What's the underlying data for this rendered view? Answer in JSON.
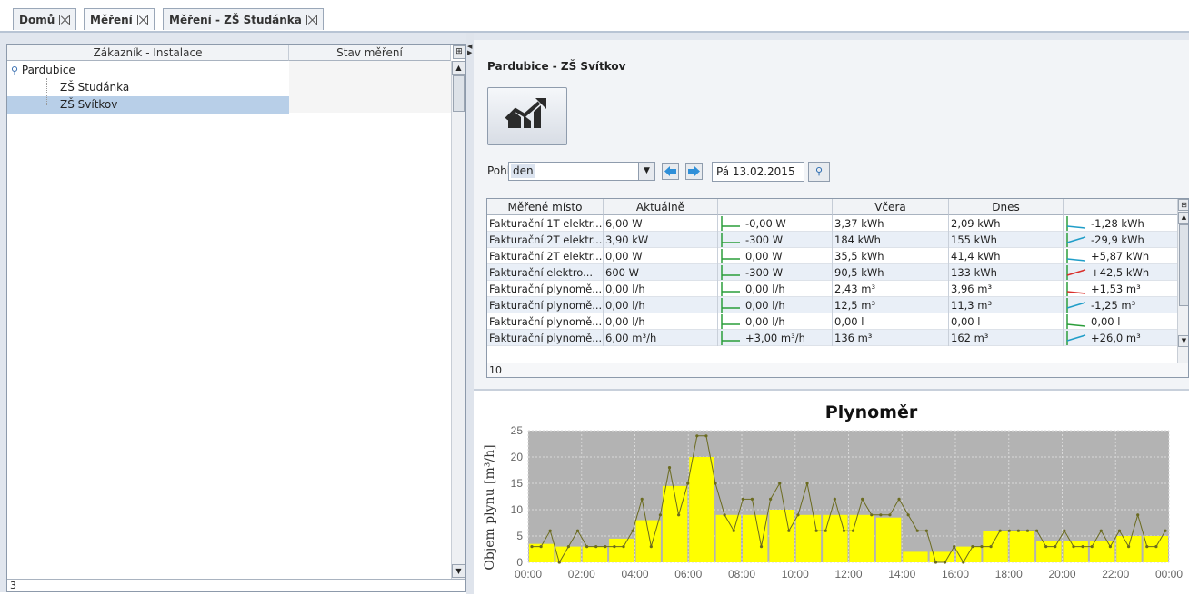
{
  "tabs": [
    {
      "label": "Domů"
    },
    {
      "label": "Měření"
    },
    {
      "label": "Měření - ZŠ Studánka"
    }
  ],
  "tree": {
    "headers": [
      "Zákazník - Instalace",
      "Stav měření"
    ],
    "items": [
      {
        "label": "Pardubice"
      },
      {
        "label": "ZŠ Studánka"
      },
      {
        "label": "ZŠ Svítkov"
      }
    ],
    "status": "3"
  },
  "detail": {
    "title": "Pardubice - ZŠ Svítkov",
    "pohled_label": "Pohled",
    "pohled_value": "den",
    "date": "Pá 13.02.2015"
  },
  "table": {
    "headers": [
      "Měřené místo",
      "Aktuálně",
      "",
      "Včera",
      "Dnes",
      ""
    ],
    "rows": [
      [
        "Fakturační 1T elektr...",
        "6,00 W",
        "-0,00 W",
        "3,37 kWh",
        "2,09 kWh",
        "-1,28 kWh"
      ],
      [
        "Fakturační 2T elektr...",
        "3,90 kW",
        "-300 W",
        "184 kWh",
        "155 kWh",
        "-29,9 kWh"
      ],
      [
        "Fakturační 2T elektr...",
        "0,00 W",
        "0,00 W",
        "35,5 kWh",
        "41,4 kWh",
        "+5,87 kWh"
      ],
      [
        "Fakturační elektro...",
        "600 W",
        "-300 W",
        "90,5 kWh",
        "133 kWh",
        "+42,5 kWh"
      ],
      [
        "Fakturační plynomě...",
        "0,00 l/h",
        "0,00 l/h",
        "2,43 m³",
        "3,96 m³",
        "+1,53 m³"
      ],
      [
        "Fakturační plynomě...",
        "0,00 l/h",
        "0,00 l/h",
        "12,5 m³",
        "11,3 m³",
        "-1,25 m³"
      ],
      [
        "Fakturační plynomě...",
        "0,00 l/h",
        "0,00 l/h",
        "0,00 l",
        "0,00 l",
        "0,00 l"
      ],
      [
        "Fakturační plynomě...",
        "6,00 m³/h",
        "+3,00 m³/h",
        "136 m³",
        "162 m³",
        "+26,0 m³"
      ]
    ],
    "trend_colors": [
      "#1f9dc8",
      "#1f9dc8",
      "#1f9dc8",
      "#d9302c",
      "#d9302c",
      "#1f9dc8",
      "#2a9d3a",
      "#1f9dc8"
    ],
    "status": "10"
  },
  "chart_data": {
    "type": "bar",
    "title": "Plynoměr",
    "ylabel": "Objem plynu [m³/h]",
    "ylim": [
      0,
      25
    ],
    "yticks": [
      "0",
      "5",
      "10",
      "15",
      "20",
      "25"
    ],
    "xticks": [
      "00:00",
      "02:00",
      "04:00",
      "06:00",
      "08:00",
      "10:00",
      "12:00",
      "14:00",
      "16:00",
      "18:00",
      "20:00",
      "22:00",
      "00:00"
    ],
    "bar_color": "#ffff00",
    "line_color": "#6b6b1f",
    "background": "#b3b3b3",
    "hourly_bars": [
      3.5,
      3,
      3,
      4.5,
      8,
      14.5,
      20,
      9,
      9,
      10,
      9,
      9,
      9,
      8.5,
      2,
      2,
      3,
      6,
      6,
      4,
      4,
      4,
      5,
      5
    ],
    "halfhour_line": [
      3,
      3,
      6,
      0,
      3,
      6,
      3,
      3,
      3,
      3,
      3,
      6,
      12,
      3,
      9,
      18,
      9,
      15,
      24,
      24,
      15,
      9,
      6,
      12,
      12,
      3,
      12,
      15,
      6,
      9,
      15,
      6,
      6,
      12,
      6,
      6,
      12,
      9,
      9,
      9,
      12,
      9,
      6,
      6,
      0,
      0,
      3,
      0,
      3,
      3,
      3,
      6,
      6,
      6,
      6,
      6,
      3,
      3,
      6,
      3,
      3,
      3,
      6,
      3,
      6,
      3,
      9,
      3,
      3,
      6
    ]
  }
}
